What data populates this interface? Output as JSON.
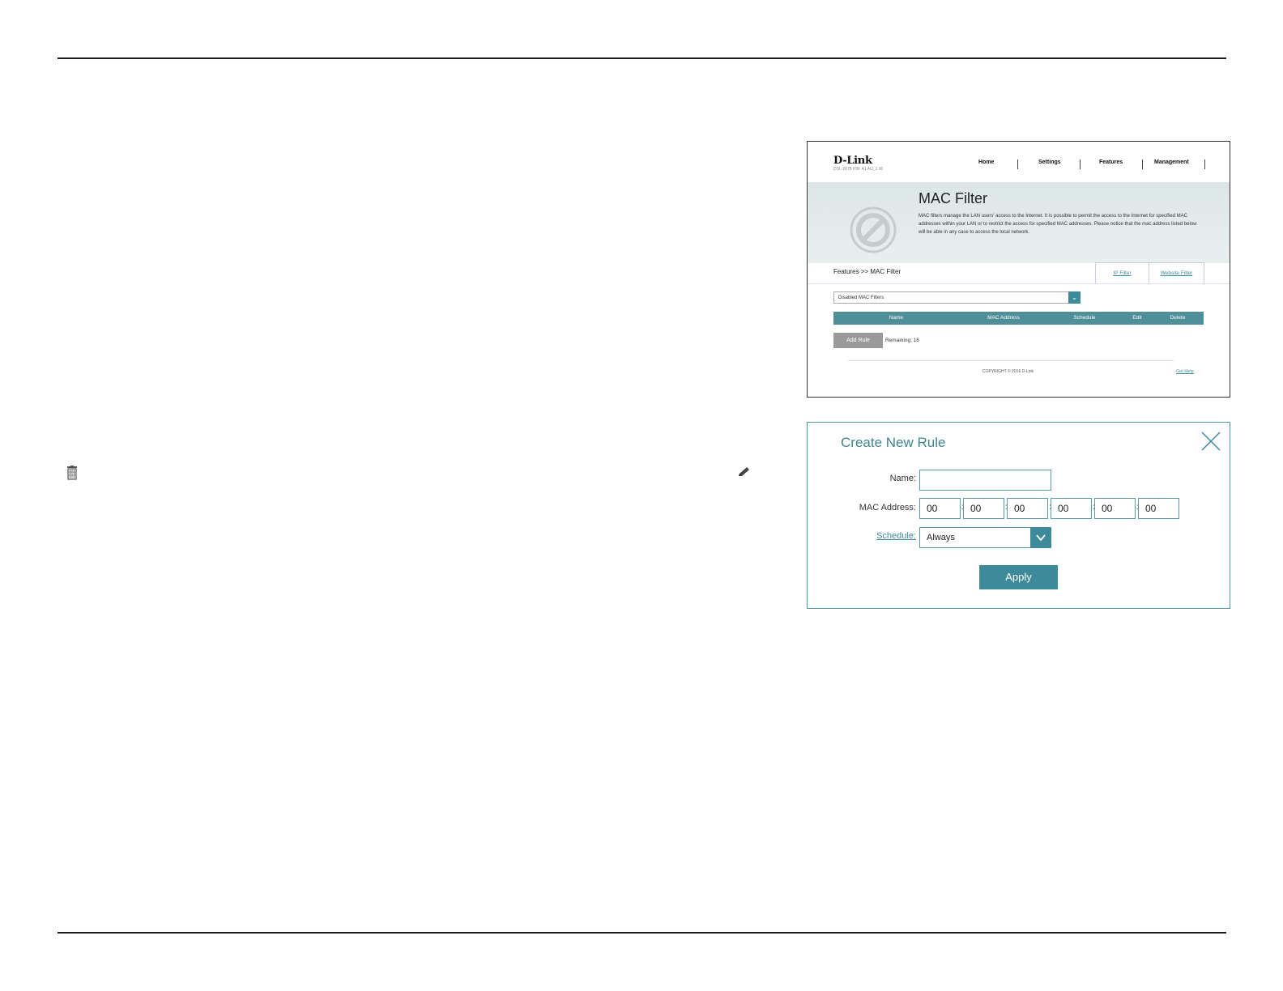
{
  "colors": {
    "accent": "#3d8a9a",
    "header_row": "#4e8f9a",
    "add_rule_button": "#9a9a9a"
  },
  "doc_icons": {
    "left": "trash-icon",
    "right": "pencil-icon"
  },
  "mac_filter_page": {
    "logo": "D-Link",
    "model": "DSL-2878   HW: A1   AU_1.00",
    "nav": [
      "Home",
      "Settings",
      "Features",
      "Management"
    ],
    "title": "MAC Filter",
    "description": "MAC filters manage the LAN users' access to the Internet. It is possible to permit the access to the Internet for specified MAC addresses within your LAN or to restrict the access for specified MAC addresses. Please notice that the mac address listed below will be able in any case to access the local network.",
    "breadcrumb": "Features >> MAC Filter",
    "tabs": [
      "IP Filter",
      "Website Filter"
    ],
    "filter_mode": "Disabled MAC Filters",
    "table_headers": [
      "Name",
      "MAC Address",
      "Schedule",
      "Edit",
      "Delete"
    ],
    "add_rule": "Add Rule",
    "remaining": "Remaining: 16",
    "copyright": "COPYRIGHT © 2016 D-Link",
    "get_help": "Get Help"
  },
  "create_rule_dialog": {
    "title": "Create New Rule",
    "name_label": "Name:",
    "name_value": "",
    "mac_label": "MAC Address:",
    "mac_octets": [
      "00",
      "00",
      "00",
      "00",
      "00",
      "00"
    ],
    "colon": ":",
    "schedule_label": "Schedule:",
    "schedule_value": "Always",
    "apply": "Apply"
  }
}
